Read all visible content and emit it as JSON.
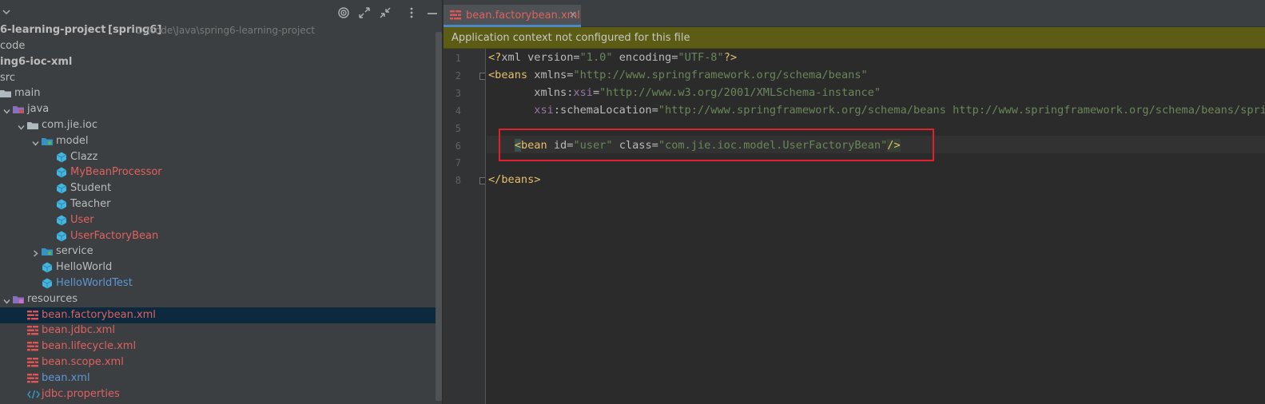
{
  "project": {
    "root_name": "6-learning-project",
    "root_module": "[spring6]",
    "root_path": "D:\\code\\Java\\spring6-learning-project",
    "tree": [
      {
        "label": "code",
        "kind": "text",
        "color": "def"
      },
      {
        "label": "ing6-ioc-xml",
        "kind": "text",
        "color": "def",
        "bold": true
      },
      {
        "label": "src",
        "kind": "text",
        "color": "def"
      },
      {
        "label": "main",
        "kind": "folder",
        "color": "def"
      },
      {
        "label": "java",
        "kind": "srcfolder",
        "color": "def"
      },
      {
        "label": "com.jie.ioc",
        "kind": "folder",
        "color": "def"
      },
      {
        "label": "model",
        "kind": "package",
        "color": "def"
      },
      {
        "label": "Clazz",
        "kind": "class",
        "color": "def"
      },
      {
        "label": "MyBeanProcessor",
        "kind": "class",
        "color": "red"
      },
      {
        "label": "Student",
        "kind": "class",
        "color": "def"
      },
      {
        "label": "Teacher",
        "kind": "class",
        "color": "def"
      },
      {
        "label": "User",
        "kind": "class",
        "color": "red"
      },
      {
        "label": "UserFactoryBean",
        "kind": "class",
        "color": "red"
      },
      {
        "label": "service",
        "kind": "package",
        "color": "def"
      },
      {
        "label": "HelloWorld",
        "kind": "class",
        "color": "def"
      },
      {
        "label": "HelloWorldTest",
        "kind": "class",
        "color": "blue"
      },
      {
        "label": "resources",
        "kind": "resfolder",
        "color": "def"
      },
      {
        "label": "bean.factorybean.xml",
        "kind": "xml",
        "color": "red",
        "selected": true
      },
      {
        "label": "bean.jdbc.xml",
        "kind": "xml",
        "color": "red"
      },
      {
        "label": "bean.lifecycle.xml",
        "kind": "xml",
        "color": "red"
      },
      {
        "label": "bean.scope.xml",
        "kind": "xml",
        "color": "red"
      },
      {
        "label": "bean.xml",
        "kind": "xml",
        "color": "blue"
      },
      {
        "label": "jdbc.properties",
        "kind": "props",
        "color": "red"
      }
    ]
  },
  "editor": {
    "tab_label": "bean.factorybean.xml",
    "tab_close": "×",
    "notification": "Application context not configured for this file",
    "line_numbers": [
      "1",
      "2",
      "3",
      "4",
      "5",
      "6",
      "7",
      "8"
    ]
  },
  "code_lines": [
    {
      "line": 1,
      "tokens": [
        {
          "t": "<?",
          "c": "pi"
        },
        {
          "t": "xml ",
          "c": "attr"
        },
        {
          "t": "version",
          "c": "attr"
        },
        {
          "t": "=",
          "c": "attr"
        },
        {
          "t": "\"1.0\"",
          "c": "str"
        },
        {
          "t": " encoding",
          "c": "attr"
        },
        {
          "t": "=",
          "c": "attr"
        },
        {
          "t": "\"UTF-8\"",
          "c": "str"
        },
        {
          "t": "?>",
          "c": "pi"
        }
      ]
    },
    {
      "line": 2,
      "tokens": [
        {
          "t": "<beans",
          "c": "tag"
        },
        {
          "t": " xmlns",
          "c": "attr"
        },
        {
          "t": "=",
          "c": "attr"
        },
        {
          "t": "\"http://www.springframework.org/schema/beans\"",
          "c": "str"
        }
      ]
    },
    {
      "line": 3,
      "tokens": [
        {
          "t": "       xmlns",
          "c": "attr"
        },
        {
          "t": ":",
          "c": "attr"
        },
        {
          "t": "xsi",
          "c": "ns"
        },
        {
          "t": "=",
          "c": "attr"
        },
        {
          "t": "\"http://www.w3.org/2001/XMLSchema-instance\"",
          "c": "str"
        }
      ]
    },
    {
      "line": 4,
      "tokens": [
        {
          "t": "       xsi",
          "c": "ns"
        },
        {
          "t": ":schemaLocation",
          "c": "attr"
        },
        {
          "t": "=",
          "c": "attr"
        },
        {
          "t": "\"http://www.springframework.org/schema/beans http://www.springframework.org/schema/beans/spring",
          "c": "str"
        }
      ]
    },
    {
      "line": 5,
      "tokens": []
    },
    {
      "line": 6,
      "tokens": [
        {
          "t": "    ",
          "c": "attr"
        },
        {
          "t": "<",
          "c": "hl"
        },
        {
          "t": "bean",
          "c": "tag"
        },
        {
          "t": " id",
          "c": "attr"
        },
        {
          "t": "=",
          "c": "attr"
        },
        {
          "t": "\"user\"",
          "c": "str"
        },
        {
          "t": " class",
          "c": "attr"
        },
        {
          "t": "=",
          "c": "attr"
        },
        {
          "t": "\"com.jie.ioc.model.UserFactoryBean\"",
          "c": "str"
        },
        {
          "t": "/>",
          "c": "hl2"
        }
      ]
    },
    {
      "line": 7,
      "tokens": []
    },
    {
      "line": 8,
      "tokens": [
        {
          "t": "</beans>",
          "c": "tag"
        }
      ]
    }
  ],
  "colors": {
    "panel_bg": "#3c3f41",
    "editor_bg": "#2b2b2b",
    "selection": "#0d293e",
    "modified_file": "#e06060",
    "new_file": "#5d96d6",
    "notification_bg": "#5c5c14",
    "highlight_box": "#e0202a"
  },
  "icons": [
    "chevron-down-icon",
    "target-icon",
    "expand-icon",
    "collapse-icon",
    "more-options-icon",
    "minimize-icon",
    "folder-icon",
    "source-folder-icon",
    "package-icon",
    "class-icon",
    "xml-file-icon",
    "properties-file-icon"
  ]
}
